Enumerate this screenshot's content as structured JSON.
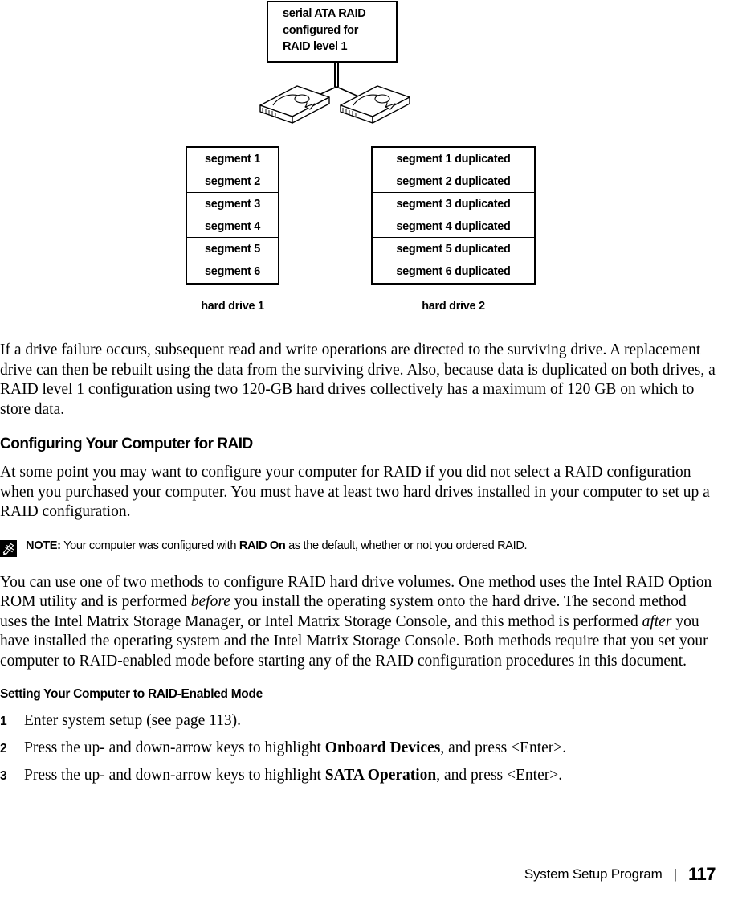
{
  "figure": {
    "callout": {
      "text": "serial ATA RAID\nconfigured for\nRAID level 1"
    },
    "drive_left_label": "hard drive 1",
    "drive_right_label": "hard drive 2",
    "table_left": {
      "rows": [
        "segment 1",
        "segment 2",
        "segment 3",
        "segment 4",
        "segment 5",
        "segment 6"
      ]
    },
    "table_right": {
      "rows": [
        "segment 1 duplicated",
        "segment 2 duplicated",
        "segment 3 duplicated",
        "segment 4 duplicated",
        "segment 5 duplicated",
        "segment 6 duplicated"
      ]
    }
  },
  "body": {
    "para_failure": "If a drive failure occurs, subsequent read and write operations are directed to the surviving drive. A replacement drive can then be rebuilt using the data from the surviving drive. Also, because data is duplicated on both drives, a RAID level 1 configuration using two 120-GB hard drives collectively has a maximum of 120 GB on which to store data.",
    "heading_configuring": "Configuring Your Computer for RAID",
    "para_configuring": "At some point you may want to configure your computer for RAID if you did not select a RAID configuration when you purchased your computer. You must have at least two hard drives installed in your computer to set up a RAID configuration.",
    "note": {
      "label": "NOTE:",
      "text_1": " Your computer was configured with ",
      "bold_1": "RAID On",
      "text_2": " as the default, whether or not you ordered RAID."
    },
    "para_methods": {
      "t1": "You can use one of two methods to configure RAID hard drive volumes. One method uses the Intel RAID Option ROM utility and is performed ",
      "i1": "before",
      "t2": " you install the operating system onto the hard drive. The second method uses the Intel Matrix Storage Manager, or Intel Matrix Storage Console, and this method is performed ",
      "i2": "after",
      "t3": " you have installed the operating system and the Intel Matrix Storage Console. Both methods require that you set your computer to RAID-enabled mode before starting any of the RAID configuration procedures in this document."
    },
    "heading_setting": "Setting Your Computer to RAID-Enabled Mode",
    "steps": [
      {
        "num": "1",
        "t1": "Enter system setup (see page 113).",
        "b1": "",
        "t2": ""
      },
      {
        "num": "2",
        "t1": "Press the up- and down-arrow keys to highlight ",
        "b1": "Onboard Devices",
        "t2": ", and press <Enter>."
      },
      {
        "num": "3",
        "t1": "Press the up- and down-arrow keys to highlight ",
        "b1": "SATA Operation",
        "t2": ", and press <Enter>."
      }
    ]
  },
  "footer": {
    "title": "System Setup Program",
    "separator": "|",
    "page": "117"
  }
}
